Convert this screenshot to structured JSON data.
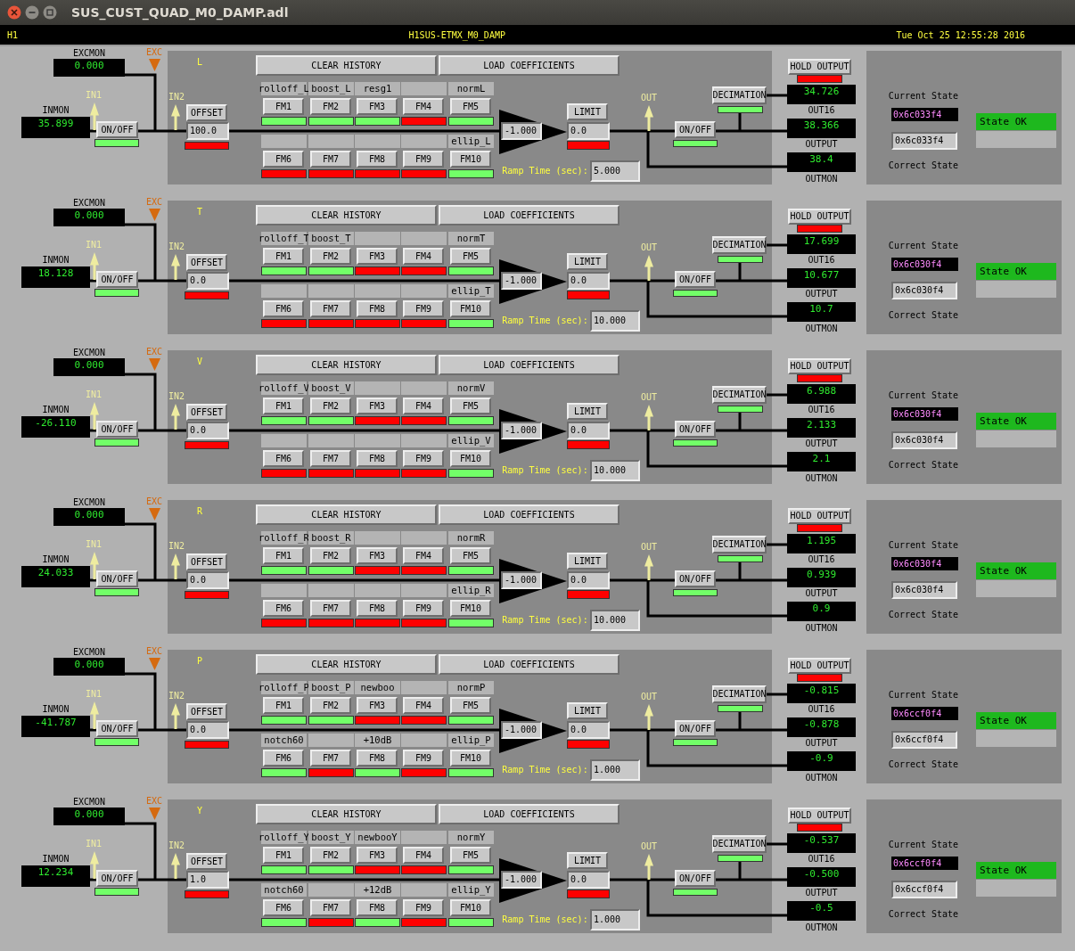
{
  "window": {
    "title": "SUS_CUST_QUAD_M0_DAMP.adl"
  },
  "header": {
    "site": "H1",
    "system": "H1SUS-ETMX_M0_DAMP",
    "timestamp": "Tue Oct 25 12:55:28 2016"
  },
  "rows": [
    {
      "dof": "L",
      "excmon_label": "EXCMON",
      "excmon": "0.000",
      "exc_label": "EXC",
      "in1_label": "IN1",
      "inmon_label": "INMON",
      "inmon": "35.899",
      "input_switch": {
        "label": "ON/OFF",
        "on": true
      },
      "in2_label": "IN2",
      "offset": {
        "label": "OFFSET",
        "value": "100.0",
        "on": false
      },
      "clear_history": "CLEAR HISTORY",
      "load_coefficients": "LOAD COEFFICIENTS",
      "filters": [
        {
          "name": "rolloff_L",
          "button": "FM1",
          "on": true
        },
        {
          "name": "boost_L",
          "button": "FM2",
          "on": true
        },
        {
          "name": "resg1",
          "button": "FM3",
          "on": true
        },
        {
          "button": "FM4",
          "on": false
        },
        {
          "name": "normL",
          "button": "FM5",
          "on": true
        },
        {
          "button": "FM6",
          "on": false
        },
        {
          "button": "FM7",
          "on": false
        },
        {
          "button": "FM8",
          "on": false
        },
        {
          "button": "FM9",
          "on": false
        },
        {
          "name": "ellip_L",
          "button": "FM10",
          "on": true
        }
      ],
      "gain": "-1.000",
      "limit": {
        "label": "LIMIT",
        "value": "0.0",
        "on": false
      },
      "ramp_label": "Ramp Time (sec):",
      "ramp_time": "5.000",
      "out_label": "OUT",
      "output_switch": {
        "label": "ON/OFF",
        "on": true
      },
      "decimation": {
        "label": "DECIMATION",
        "on": true
      },
      "hold_output": {
        "label": "HOLD OUTPUT",
        "on": false
      },
      "out16": "34.726",
      "out16_label": "OUT16",
      "output": "38.366",
      "output_label": "OUTPUT",
      "outmon": "38.4",
      "outmon_label": "OUTMON",
      "current_state_label": "Current State",
      "current_state": "0x6c033f4",
      "correct_state": "0x6c033f4",
      "correct_state_label": "Correct State",
      "state_status": "State OK",
      "state_ok": true
    },
    {
      "dof": "T",
      "excmon_label": "EXCMON",
      "excmon": "0.000",
      "exc_label": "EXC",
      "in1_label": "IN1",
      "inmon_label": "INMON",
      "inmon": "18.128",
      "input_switch": {
        "label": "ON/OFF",
        "on": true
      },
      "in2_label": "IN2",
      "offset": {
        "label": "OFFSET",
        "value": "0.0",
        "on": false
      },
      "clear_history": "CLEAR HISTORY",
      "load_coefficients": "LOAD COEFFICIENTS",
      "filters": [
        {
          "name": "rolloff_T",
          "button": "FM1",
          "on": true
        },
        {
          "name": "boost_T",
          "button": "FM2",
          "on": true
        },
        {
          "button": "FM3",
          "on": false
        },
        {
          "button": "FM4",
          "on": false
        },
        {
          "name": "normT",
          "button": "FM5",
          "on": true
        },
        {
          "button": "FM6",
          "on": false
        },
        {
          "button": "FM7",
          "on": false
        },
        {
          "button": "FM8",
          "on": false
        },
        {
          "button": "FM9",
          "on": false
        },
        {
          "name": "ellip_T",
          "button": "FM10",
          "on": true
        }
      ],
      "gain": "-1.000",
      "limit": {
        "label": "LIMIT",
        "value": "0.0",
        "on": false
      },
      "ramp_label": "Ramp Time (sec):",
      "ramp_time": "10.000",
      "out_label": "OUT",
      "output_switch": {
        "label": "ON/OFF",
        "on": true
      },
      "decimation": {
        "label": "DECIMATION",
        "on": true
      },
      "hold_output": {
        "label": "HOLD OUTPUT",
        "on": false
      },
      "out16": "17.699",
      "out16_label": "OUT16",
      "output": "10.677",
      "output_label": "OUTPUT",
      "outmon": "10.7",
      "outmon_label": "OUTMON",
      "current_state_label": "Current State",
      "current_state": "0x6c030f4",
      "correct_state": "0x6c030f4",
      "correct_state_label": "Correct State",
      "state_status": "State OK",
      "state_ok": true
    },
    {
      "dof": "V",
      "excmon_label": "EXCMON",
      "excmon": "0.000",
      "exc_label": "EXC",
      "in1_label": "IN1",
      "inmon_label": "INMON",
      "inmon": "-26.110",
      "input_switch": {
        "label": "ON/OFF",
        "on": true
      },
      "in2_label": "IN2",
      "offset": {
        "label": "OFFSET",
        "value": "0.0",
        "on": false
      },
      "clear_history": "CLEAR HISTORY",
      "load_coefficients": "LOAD COEFFICIENTS",
      "filters": [
        {
          "name": "rolloff_V",
          "button": "FM1",
          "on": true
        },
        {
          "name": "boost_V",
          "button": "FM2",
          "on": true
        },
        {
          "button": "FM3",
          "on": false
        },
        {
          "button": "FM4",
          "on": false
        },
        {
          "name": "normV",
          "button": "FM5",
          "on": true
        },
        {
          "button": "FM6",
          "on": false
        },
        {
          "button": "FM7",
          "on": false
        },
        {
          "button": "FM8",
          "on": false
        },
        {
          "button": "FM9",
          "on": false
        },
        {
          "name": "ellip_V",
          "button": "FM10",
          "on": true
        }
      ],
      "gain": "-1.000",
      "limit": {
        "label": "LIMIT",
        "value": "0.0",
        "on": false
      },
      "ramp_label": "Ramp Time (sec):",
      "ramp_time": "10.000",
      "out_label": "OUT",
      "output_switch": {
        "label": "ON/OFF",
        "on": true
      },
      "decimation": {
        "label": "DECIMATION",
        "on": true
      },
      "hold_output": {
        "label": "HOLD OUTPUT",
        "on": false
      },
      "out16": "6.988",
      "out16_label": "OUT16",
      "output": "2.133",
      "output_label": "OUTPUT",
      "outmon": "2.1",
      "outmon_label": "OUTMON",
      "current_state_label": "Current State",
      "current_state": "0x6c030f4",
      "correct_state": "0x6c030f4",
      "correct_state_label": "Correct State",
      "state_status": "State OK",
      "state_ok": true
    },
    {
      "dof": "R",
      "excmon_label": "EXCMON",
      "excmon": "0.000",
      "exc_label": "EXC",
      "in1_label": "IN1",
      "inmon_label": "INMON",
      "inmon": "24.033",
      "input_switch": {
        "label": "ON/OFF",
        "on": true
      },
      "in2_label": "IN2",
      "offset": {
        "label": "OFFSET",
        "value": "0.0",
        "on": false
      },
      "clear_history": "CLEAR HISTORY",
      "load_coefficients": "LOAD COEFFICIENTS",
      "filters": [
        {
          "name": "rolloff_R",
          "button": "FM1",
          "on": true
        },
        {
          "name": "boost_R",
          "button": "FM2",
          "on": true
        },
        {
          "button": "FM3",
          "on": false
        },
        {
          "button": "FM4",
          "on": false
        },
        {
          "name": "normR",
          "button": "FM5",
          "on": true
        },
        {
          "button": "FM6",
          "on": false
        },
        {
          "button": "FM7",
          "on": false
        },
        {
          "button": "FM8",
          "on": false
        },
        {
          "button": "FM9",
          "on": false
        },
        {
          "name": "ellip_R",
          "button": "FM10",
          "on": true
        }
      ],
      "gain": "-1.000",
      "limit": {
        "label": "LIMIT",
        "value": "0.0",
        "on": false
      },
      "ramp_label": "Ramp Time (sec):",
      "ramp_time": "10.000",
      "out_label": "OUT",
      "output_switch": {
        "label": "ON/OFF",
        "on": true
      },
      "decimation": {
        "label": "DECIMATION",
        "on": true
      },
      "hold_output": {
        "label": "HOLD OUTPUT",
        "on": false
      },
      "out16": "1.195",
      "out16_label": "OUT16",
      "output": "0.939",
      "output_label": "OUTPUT",
      "outmon": "0.9",
      "outmon_label": "OUTMON",
      "current_state_label": "Current State",
      "current_state": "0x6c030f4",
      "correct_state": "0x6c030f4",
      "correct_state_label": "Correct State",
      "state_status": "State OK",
      "state_ok": true
    },
    {
      "dof": "P",
      "excmon_label": "EXCMON",
      "excmon": "0.000",
      "exc_label": "EXC",
      "in1_label": "IN1",
      "inmon_label": "INMON",
      "inmon": "-41.787",
      "input_switch": {
        "label": "ON/OFF",
        "on": true
      },
      "in2_label": "IN2",
      "offset": {
        "label": "OFFSET",
        "value": "0.0",
        "on": false
      },
      "clear_history": "CLEAR HISTORY",
      "load_coefficients": "LOAD COEFFICIENTS",
      "filters": [
        {
          "name": "rolloff_P",
          "button": "FM1",
          "on": true
        },
        {
          "name": "boost_P",
          "button": "FM2",
          "on": true
        },
        {
          "name": "newboo",
          "button": "FM3",
          "on": false
        },
        {
          "button": "FM4",
          "on": false
        },
        {
          "name": "normP",
          "button": "FM5",
          "on": true
        },
        {
          "name": "notch60",
          "button": "FM6",
          "on": true
        },
        {
          "button": "FM7",
          "on": false
        },
        {
          "name": "+10dB",
          "button": "FM8",
          "on": true
        },
        {
          "button": "FM9",
          "on": false
        },
        {
          "name": "ellip_P",
          "button": "FM10",
          "on": true
        }
      ],
      "gain": "-1.000",
      "limit": {
        "label": "LIMIT",
        "value": "0.0",
        "on": false
      },
      "ramp_label": "Ramp Time (sec):",
      "ramp_time": "1.000",
      "out_label": "OUT",
      "output_switch": {
        "label": "ON/OFF",
        "on": true
      },
      "decimation": {
        "label": "DECIMATION",
        "on": true
      },
      "hold_output": {
        "label": "HOLD OUTPUT",
        "on": false
      },
      "out16": "-0.815",
      "out16_label": "OUT16",
      "output": "-0.878",
      "output_label": "OUTPUT",
      "outmon": "-0.9",
      "outmon_label": "OUTMON",
      "current_state_label": "Current State",
      "current_state": "0x6ccf0f4",
      "correct_state": "0x6ccf0f4",
      "correct_state_label": "Correct State",
      "state_status": "State OK",
      "state_ok": true
    },
    {
      "dof": "Y",
      "excmon_label": "EXCMON",
      "excmon": "0.000",
      "exc_label": "EXC",
      "in1_label": "IN1",
      "inmon_label": "INMON",
      "inmon": "12.234",
      "input_switch": {
        "label": "ON/OFF",
        "on": true
      },
      "in2_label": "IN2",
      "offset": {
        "label": "OFFSET",
        "value": "1.0",
        "on": false
      },
      "clear_history": "CLEAR HISTORY",
      "load_coefficients": "LOAD COEFFICIENTS",
      "filters": [
        {
          "name": "rolloff_Y",
          "button": "FM1",
          "on": true
        },
        {
          "name": "boost_Y",
          "button": "FM2",
          "on": true
        },
        {
          "name": "newbooY",
          "button": "FM3",
          "on": false
        },
        {
          "button": "FM4",
          "on": false
        },
        {
          "name": "normY",
          "button": "FM5",
          "on": true
        },
        {
          "name": "notch60",
          "button": "FM6",
          "on": true
        },
        {
          "button": "FM7",
          "on": false
        },
        {
          "name": "+12dB",
          "button": "FM8",
          "on": true
        },
        {
          "button": "FM9",
          "on": false
        },
        {
          "name": "ellip_Y",
          "button": "FM10",
          "on": true
        }
      ],
      "gain": "-1.000",
      "limit": {
        "label": "LIMIT",
        "value": "0.0",
        "on": false
      },
      "ramp_label": "Ramp Time (sec):",
      "ramp_time": "1.000",
      "out_label": "OUT",
      "output_switch": {
        "label": "ON/OFF",
        "on": true
      },
      "decimation": {
        "label": "DECIMATION",
        "on": true
      },
      "hold_output": {
        "label": "HOLD OUTPUT",
        "on": false
      },
      "out16": "-0.537",
      "out16_label": "OUT16",
      "output": "-0.500",
      "output_label": "OUTPUT",
      "outmon": "-0.5",
      "outmon_label": "OUTMON",
      "current_state_label": "Current State",
      "current_state": "0x6ccf0f4",
      "correct_state": "0x6ccf0f4",
      "correct_state_label": "Correct State",
      "state_status": "State OK",
      "state_ok": true
    }
  ]
}
